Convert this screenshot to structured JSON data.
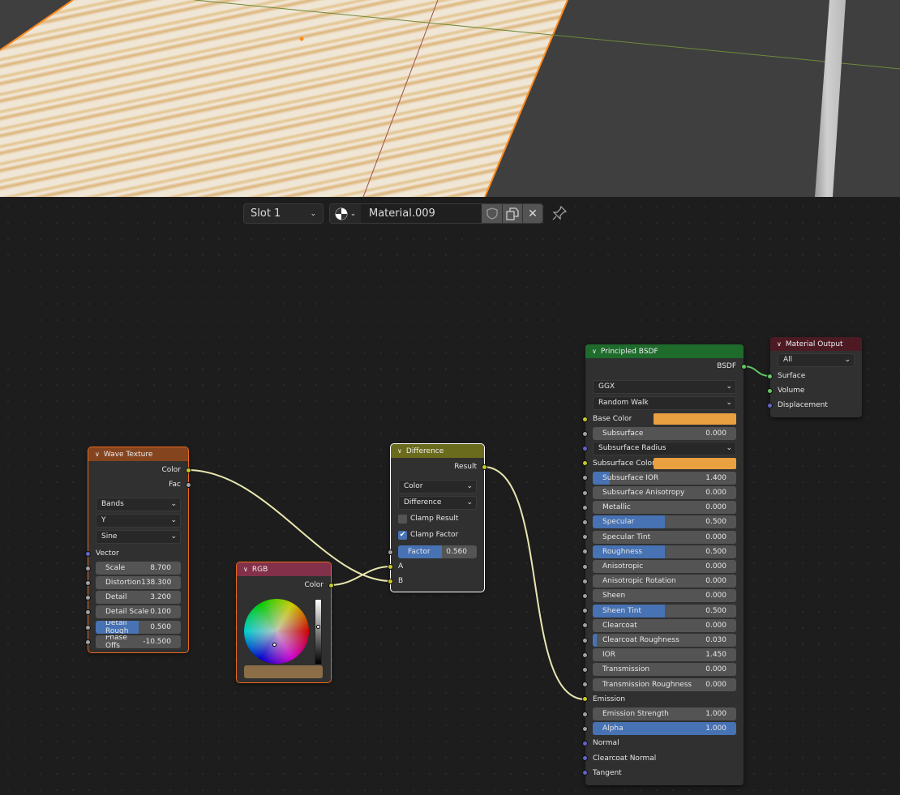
{
  "header": {
    "slot": "Slot 1",
    "material_name": "Material.009",
    "icons": [
      "material-sphere-icon",
      "shield-fake-user-icon",
      "duplicate-icon",
      "close-icon",
      "pin-icon"
    ]
  },
  "colors": {
    "yellow": "#c7c729",
    "gray": "#a1a1a1",
    "purple": "#6363c7",
    "green": "#63c763",
    "accent": "#4772b3",
    "selected": "#ed6a1f"
  },
  "nodes": [
    {
      "id": "wave",
      "title": "Wave Texture",
      "header_color": "#84441e",
      "rows": [
        {
          "t": "out",
          "label": "Color",
          "sock": "yellow"
        },
        {
          "t": "out",
          "label": "Fac",
          "sock": "gray"
        },
        {
          "t": "dd",
          "label": "Bands"
        },
        {
          "t": "dd",
          "label": "Y"
        },
        {
          "t": "dd",
          "label": "Sine"
        },
        {
          "t": "in",
          "label": "Vector",
          "sock": "purple"
        },
        {
          "t": "field",
          "label": "Scale",
          "value": "8.700",
          "sock": "gray"
        },
        {
          "t": "field",
          "label": "Distortion",
          "value": "138.300",
          "sock": "gray"
        },
        {
          "t": "field",
          "label": "Detail",
          "value": "3.200",
          "sock": "gray"
        },
        {
          "t": "field",
          "label": "Detail Scale",
          "value": "0.100",
          "sock": "gray"
        },
        {
          "t": "field",
          "label": "Detail Rough",
          "value": "0.500",
          "sock": "gray",
          "fill": 0.5
        },
        {
          "t": "field",
          "label": "Phase Offs",
          "value": "-10.500",
          "sock": "gray"
        }
      ]
    },
    {
      "id": "rgb",
      "title": "RGB",
      "header_color": "#83314a",
      "swatch": "#8b6e48",
      "rows": [
        {
          "t": "out",
          "label": "Color",
          "sock": "yellow"
        }
      ]
    },
    {
      "id": "diff",
      "title": "Difference",
      "header_color": "#6b6b1d",
      "rows": [
        {
          "t": "out",
          "label": "Result",
          "sock": "yellow"
        },
        {
          "t": "dd",
          "label": "Color"
        },
        {
          "t": "dd",
          "label": "Difference"
        },
        {
          "t": "cb",
          "label": "Clamp Result",
          "checked": false
        },
        {
          "t": "cb",
          "label": "Clamp Factor",
          "checked": true
        },
        {
          "t": "field",
          "label": "Factor",
          "value": "0.560",
          "sock": "gray",
          "fill": 0.56
        },
        {
          "t": "in",
          "label": "A",
          "sock": "yellow"
        },
        {
          "t": "in",
          "label": "B",
          "sock": "yellow"
        }
      ]
    },
    {
      "id": "bsdf",
      "title": "Principled BSDF",
      "header_color": "#1e6b2c",
      "rows": [
        {
          "t": "out",
          "label": "BSDF",
          "sock": "green"
        },
        {
          "t": "dd",
          "label": "GGX"
        },
        {
          "t": "dd",
          "label": "Random Walk"
        },
        {
          "t": "color",
          "label": "Base Color",
          "sock": "yellow",
          "color": "#e8a040"
        },
        {
          "t": "field",
          "label": "Subsurface",
          "value": "0.000",
          "sock": "gray"
        },
        {
          "t": "dd",
          "label": "Subsurface Radius",
          "sock": "purple"
        },
        {
          "t": "color",
          "label": "Subsurface Color",
          "sock": "yellow",
          "color": "#e8a040"
        },
        {
          "t": "field",
          "label": "Subsurface IOR",
          "value": "1.400",
          "sock": "gray",
          "fill": 0.12
        },
        {
          "t": "field",
          "label": "Subsurface Anisotropy",
          "value": "0.000",
          "sock": "gray"
        },
        {
          "t": "field",
          "label": "Metallic",
          "value": "0.000",
          "sock": "gray"
        },
        {
          "t": "field",
          "label": "Specular",
          "value": "0.500",
          "sock": "gray",
          "fill": 0.5
        },
        {
          "t": "field",
          "label": "Specular Tint",
          "value": "0.000",
          "sock": "gray"
        },
        {
          "t": "field",
          "label": "Roughness",
          "value": "0.500",
          "sock": "gray",
          "fill": 0.5
        },
        {
          "t": "field",
          "label": "Anisotropic",
          "value": "0.000",
          "sock": "gray"
        },
        {
          "t": "field",
          "label": "Anisotropic Rotation",
          "value": "0.000",
          "sock": "gray"
        },
        {
          "t": "field",
          "label": "Sheen",
          "value": "0.000",
          "sock": "gray"
        },
        {
          "t": "field",
          "label": "Sheen Tint",
          "value": "0.500",
          "sock": "gray",
          "fill": 0.5
        },
        {
          "t": "field",
          "label": "Clearcoat",
          "value": "0.000",
          "sock": "gray"
        },
        {
          "t": "field",
          "label": "Clearcoat Roughness",
          "value": "0.030",
          "sock": "gray",
          "fill": 0.03
        },
        {
          "t": "field",
          "label": "IOR",
          "value": "1.450",
          "sock": "gray"
        },
        {
          "t": "field",
          "label": "Transmission",
          "value": "0.000",
          "sock": "gray"
        },
        {
          "t": "field",
          "label": "Transmission Roughness",
          "value": "0.000",
          "sock": "gray"
        },
        {
          "t": "in",
          "label": "Emission",
          "sock": "yellow"
        },
        {
          "t": "field",
          "label": "Emission Strength",
          "value": "1.000",
          "sock": "gray"
        },
        {
          "t": "field",
          "label": "Alpha",
          "value": "1.000",
          "sock": "gray",
          "fill": 1.0
        },
        {
          "t": "in",
          "label": "Normal",
          "sock": "purple"
        },
        {
          "t": "in",
          "label": "Clearcoat Normal",
          "sock": "purple"
        },
        {
          "t": "in",
          "label": "Tangent",
          "sock": "purple"
        }
      ]
    },
    {
      "id": "out",
      "title": "Material Output",
      "header_color": "#4d1a24",
      "rows": [
        {
          "t": "dd",
          "label": "All"
        },
        {
          "t": "in",
          "label": "Surface",
          "sock": "green"
        },
        {
          "t": "in",
          "label": "Volume",
          "sock": "green"
        },
        {
          "t": "in",
          "label": "Displacement",
          "sock": "purple"
        }
      ]
    }
  ]
}
